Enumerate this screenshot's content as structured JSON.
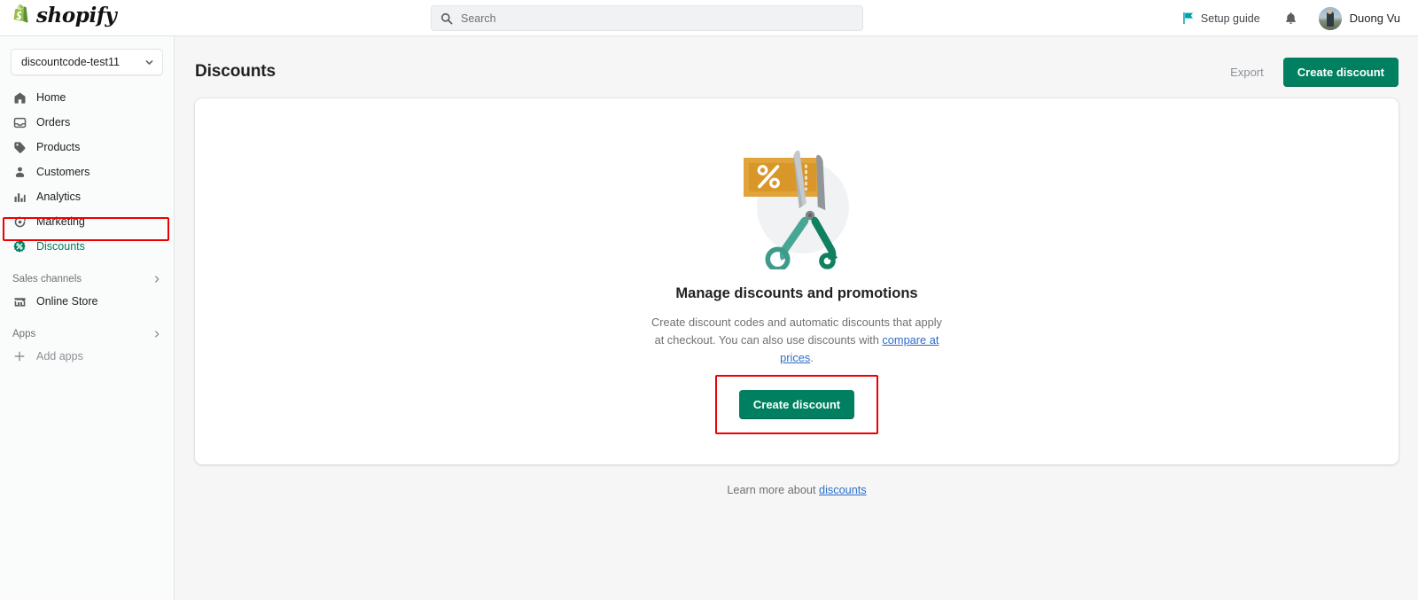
{
  "topbar": {
    "logo_text": "shopify",
    "search": {
      "placeholder": "Search",
      "value": "",
      "icon": "search-icon"
    },
    "setup_guide": {
      "label": "Setup guide",
      "icon": "flag-icon"
    },
    "notifications": {
      "icon": "bell-icon"
    },
    "user": {
      "name": "Duong Vu",
      "avatar": "user-avatar"
    }
  },
  "sidebar": {
    "store_selector": {
      "name": "discountcode-test11",
      "icon": "chevron-down-icon"
    },
    "items": [
      {
        "label": "Home",
        "icon": "home-icon",
        "active": false
      },
      {
        "label": "Orders",
        "icon": "orders-inbox-icon",
        "active": false
      },
      {
        "label": "Products",
        "icon": "products-tag-icon",
        "active": false
      },
      {
        "label": "Customers",
        "icon": "customers-person-icon",
        "active": false
      },
      {
        "label": "Analytics",
        "icon": "analytics-bars-icon",
        "active": false
      },
      {
        "label": "Marketing",
        "icon": "marketing-target-icon",
        "active": false
      },
      {
        "label": "Discounts",
        "icon": "discounts-percent-badge-icon",
        "active": true
      }
    ],
    "sales_channels": {
      "label": "Sales channels",
      "icon": "chevron-right-icon"
    },
    "online_store": {
      "label": "Online Store",
      "icon": "storefront-icon"
    },
    "apps": {
      "label": "Apps",
      "icon": "chevron-right-icon"
    },
    "add_apps": {
      "label": "Add apps",
      "icon": "plus-icon"
    }
  },
  "page": {
    "title": "Discounts",
    "export_label": "Export",
    "create_label": "Create discount"
  },
  "empty_state": {
    "illustration": "scissors-cutting-discount-coupon-illustration",
    "title": "Manage discounts and promotions",
    "description_part1": "Create discount codes and automatic discounts that apply at checkout. You can also use discounts with ",
    "description_link": "compare at prices",
    "description_part2": ".",
    "cta_label": "Create discount"
  },
  "footer": {
    "learn_more_text": "Learn more about ",
    "learn_more_link": "discounts"
  },
  "annotations": {
    "highlight_color": "#ee0000",
    "targets": [
      "sidebar-item-discounts",
      "empty-state-create-discount-button"
    ]
  },
  "colors": {
    "brand_green": "#008060",
    "active_green": "#007b5c",
    "link_blue": "#2c6ecb",
    "page_bg": "#f6f6f7",
    "sidebar_bg": "#fafbfb"
  }
}
